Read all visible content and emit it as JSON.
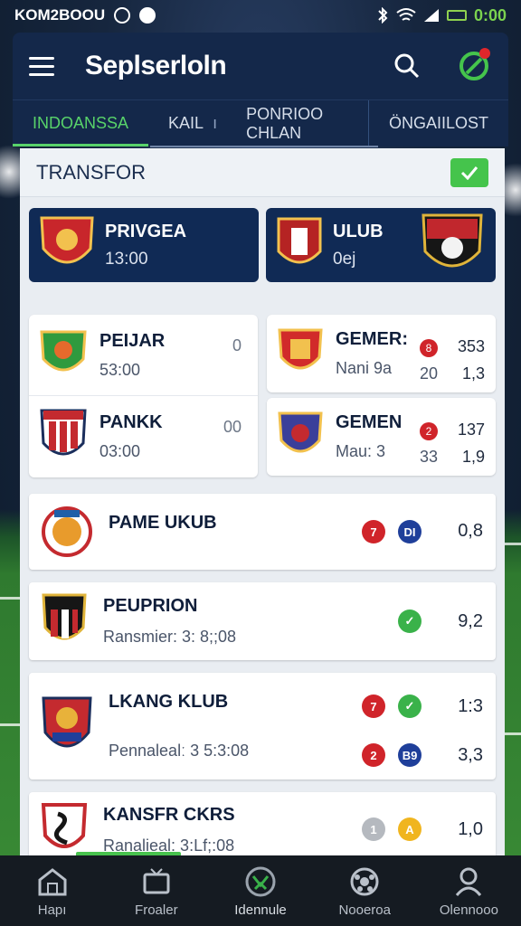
{
  "status_bar": {
    "left_text": "KOM2BOOU",
    "time": "0:00"
  },
  "app_bar": {
    "title": "Seplserloln",
    "icons": [
      "menu-icon",
      "search-icon",
      "whistle-icon"
    ]
  },
  "tabs": [
    {
      "label": "INDOANSSA",
      "active": true
    },
    {
      "label": "KAIL"
    },
    {
      "label": "PONRIOO CHLAN"
    },
    {
      "label": "ÖNGAIILOST"
    }
  ],
  "section": {
    "title": "TRANSFOR"
  },
  "featured": [
    {
      "name": "PRIVGEA",
      "sub": "13:00",
      "crest_color": "#c8262b"
    },
    {
      "name": "ULUB",
      "sub": "0ej",
      "crest_color": "#b52323"
    }
  ],
  "left_cards": [
    {
      "name": "PEIJAR",
      "sub": "53:00",
      "value": "0",
      "crest_color": "#2f9a3e"
    },
    {
      "name": "PANKK",
      "sub": "03:00",
      "value": "00",
      "crest_color": "#c42a2f"
    }
  ],
  "right_cards": [
    {
      "name": "GEMER:",
      "sub": "Nani 9a",
      "badge": "8",
      "mid": "20",
      "value_top": "353",
      "value_bottom": "1,3",
      "crest_color": "#d12a2a"
    },
    {
      "name": "GEMEN",
      "sub": "Mau: 3",
      "badge": "2",
      "mid": "33",
      "value_top": "137",
      "value_bottom": "1,9",
      "crest_color": "#3a3f9a"
    }
  ],
  "list": [
    {
      "name": "PAME UKUB",
      "sub": "",
      "badges": [
        {
          "text": "7",
          "color": "red"
        },
        {
          "text": "DI",
          "color": "blue"
        }
      ],
      "value": "0,8"
    },
    {
      "name": "PEUPRION",
      "sub": "Ransmier: 3: 8;;08",
      "badges": [
        {
          "text": "",
          "color": "green"
        }
      ],
      "value": "9,2"
    },
    {
      "name": "LKANG KLUB",
      "sub": "Pennalealː 3 5:3:08",
      "badges_top": [
        {
          "text": "7",
          "color": "red"
        },
        {
          "text": "",
          "color": "green"
        }
      ],
      "badges_bottom": [
        {
          "text": "2",
          "color": "red"
        },
        {
          "text": "B9",
          "color": "blue"
        }
      ],
      "value_top": "1:3",
      "value_bottom": "3,3"
    },
    {
      "name": "KANSFR CKRS",
      "sub": "Ranalieal: 3:Lf;:08",
      "badges": [
        {
          "text": "1",
          "color": "grey"
        },
        {
          "text": "A",
          "color": "yellow"
        }
      ],
      "value": "1,0"
    }
  ],
  "bottom_nav": [
    {
      "label": "Hapı",
      "icon": "home-icon"
    },
    {
      "label": "Froaler",
      "icon": "tv-icon"
    },
    {
      "label": "Idennule",
      "icon": "ball-icon",
      "active": true
    },
    {
      "label": "Nooeroa",
      "icon": "football-icon"
    },
    {
      "label": "Olennooo",
      "icon": "profile-icon"
    }
  ],
  "colors": {
    "accent_green": "#45c44c",
    "navy": "#14284a",
    "card_navy": "#102a55",
    "badge_red": "#d0242a",
    "badge_blue": "#1f3f9a"
  }
}
